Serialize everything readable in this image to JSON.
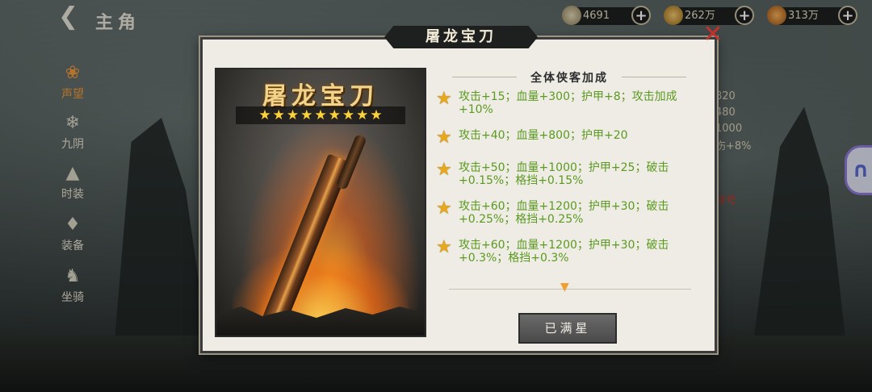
{
  "header": {
    "title": "主角",
    "resources": [
      {
        "icon": "silver-ingot-icon",
        "value": "4691"
      },
      {
        "icon": "copper-coin-icon",
        "value": "262万"
      },
      {
        "icon": "gold-coin-icon",
        "value": "313万"
      }
    ]
  },
  "sidebar": {
    "items": [
      {
        "icon": "lotus-icon",
        "label": "声望"
      },
      {
        "icon": "flame-icon",
        "label": "九阴"
      },
      {
        "icon": "robe-icon",
        "label": "时装"
      },
      {
        "icon": "armor-icon",
        "label": "装备"
      },
      {
        "icon": "horse-icon",
        "label": "坐骑"
      }
    ]
  },
  "right_panel": {
    "values": [
      "820",
      "480",
      "1000",
      "伤+8%"
    ],
    "badge": "称号"
  },
  "dialog": {
    "title": "屠龙宝刀",
    "weapon_name": "屠龙宝刀",
    "stars": 9,
    "bonus_header": "全体侠客加成",
    "bonuses": [
      "攻击+15；血量+300；护甲+8；攻击加成+10%",
      "攻击+40；血量+800；护甲+20",
      "攻击+50；血量+1000；护甲+25；破击+0.15%；格挡+0.15%",
      "攻击+60；血量+1200；护甲+30；破击+0.25%；格挡+0.25%",
      "攻击+60；血量+1200；护甲+30；破击+0.3%；格挡+0.3%"
    ],
    "button_label": "已满星"
  }
}
